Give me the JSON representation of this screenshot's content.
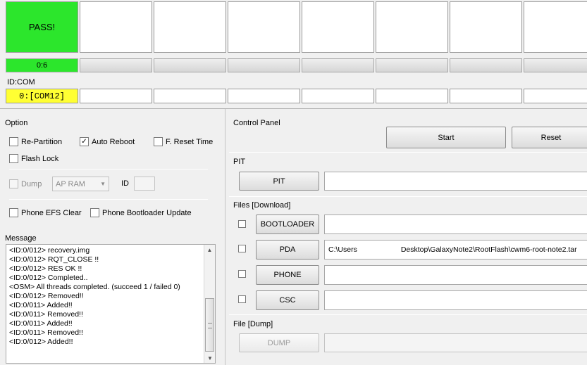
{
  "status": {
    "pass_label": "PASS!",
    "progress_label": "0:6",
    "id_com_label": "ID:COM",
    "com_value": "0:[COM12]",
    "colors": {
      "pass": "#2ce62c",
      "active_com": "#ffff33"
    }
  },
  "option": {
    "title": "Option",
    "re_partition": {
      "label": "Re-Partition",
      "checked": false
    },
    "auto_reboot": {
      "label": "Auto Reboot",
      "checked": true
    },
    "f_reset_time": {
      "label": "F. Reset Time",
      "checked": false
    },
    "flash_lock": {
      "label": "Flash Lock",
      "checked": false
    },
    "dump": {
      "label": "Dump",
      "checked": false,
      "enabled": false
    },
    "dump_select": {
      "value": "AP RAM"
    },
    "id_label": "ID",
    "phone_efs_clear": {
      "label": "Phone EFS Clear",
      "checked": false
    },
    "phone_bootloader_update": {
      "label": "Phone Bootloader Update",
      "checked": false
    }
  },
  "message": {
    "title": "Message",
    "lines": [
      "<ID:0/012> recovery.img",
      "<ID:0/012> RQT_CLOSE !!",
      "<ID:0/012> RES OK !!",
      "<ID:0/012> Completed..",
      "<OSM> All threads completed. (succeed 1 / failed 0)",
      "<ID:0/012> Removed!!",
      "<ID:0/011> Added!!",
      "<ID:0/011> Removed!!",
      "<ID:0/011> Added!!",
      "<ID:0/011> Removed!!",
      "<ID:0/012> Added!!"
    ]
  },
  "control_panel": {
    "title": "Control Panel",
    "start_label": "Start",
    "reset_label": "Reset"
  },
  "pit": {
    "title": "PIT",
    "button_label": "PIT"
  },
  "files": {
    "title": "Files [Download]",
    "bootloader": {
      "label": "BOOTLOADER",
      "checked": false,
      "path": ""
    },
    "pda": {
      "label": "PDA",
      "checked": false,
      "path_prefix": "C:\\Users",
      "path_suffix": "Desktop\\GalaxyNote2\\RootFlash\\cwm6-root-note2.tar"
    },
    "phone": {
      "label": "PHONE",
      "checked": false,
      "path": ""
    },
    "csc": {
      "label": "CSC",
      "checked": false,
      "path": ""
    }
  },
  "file_dump": {
    "title": "File [Dump]",
    "button_label": "DUMP"
  }
}
